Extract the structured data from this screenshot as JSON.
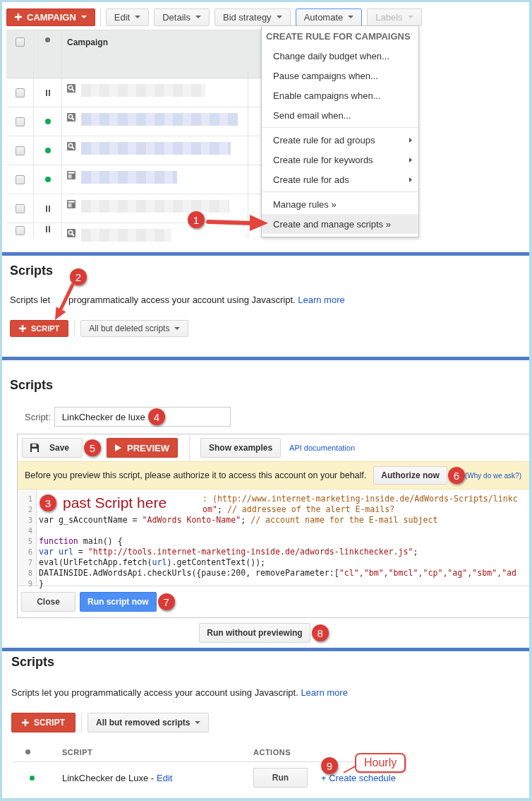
{
  "campaigns": {
    "new_button": "CAMPAIGN",
    "toolbar": [
      {
        "label": "Edit",
        "expanded": false,
        "disabled": false
      },
      {
        "label": "Details",
        "expanded": false,
        "disabled": false
      },
      {
        "label": "Bid strategy",
        "expanded": false,
        "disabled": false
      },
      {
        "label": "Automate",
        "expanded": true,
        "disabled": false
      },
      {
        "label": "Labels",
        "expanded": false,
        "disabled": true
      }
    ],
    "table": {
      "columns": [
        "Campaign"
      ],
      "select_all_checked": false,
      "rows": [
        {
          "checked": false,
          "paused": true,
          "kind": "search"
        },
        {
          "checked": false,
          "paused": false,
          "kind": "search"
        },
        {
          "checked": false,
          "paused": false,
          "kind": "search"
        },
        {
          "checked": false,
          "paused": false,
          "kind": "display"
        },
        {
          "checked": false,
          "paused": true,
          "kind": "display"
        },
        {
          "checked": false,
          "paused": true,
          "kind": "search"
        }
      ]
    },
    "automate_menu": {
      "heading": "CREATE RULE FOR CAMPAIGNS",
      "groups": [
        {
          "items": [
            {
              "label": "Change daily budget when...",
              "submenu": false,
              "selected": false
            },
            {
              "label": "Pause campaigns when...",
              "submenu": false,
              "selected": false
            },
            {
              "label": "Enable campaigns when...",
              "submenu": false,
              "selected": false
            },
            {
              "label": "Send email when...",
              "submenu": false,
              "selected": false
            }
          ]
        },
        {
          "items": [
            {
              "label": "Create rule for ad groups",
              "submenu": true,
              "selected": false
            },
            {
              "label": "Create rule for keywords",
              "submenu": true,
              "selected": false
            },
            {
              "label": "Create rule for ads",
              "submenu": true,
              "selected": false
            }
          ]
        },
        {
          "items": [
            {
              "label": "Manage rules »",
              "submenu": false,
              "selected": false
            },
            {
              "label": "Create and manage scripts »",
              "submenu": false,
              "selected": true
            }
          ]
        }
      ]
    },
    "step_marker": "1"
  },
  "scripts_intro": {
    "title": "Scripts",
    "description_parts": [
      "Scripts let",
      "programmatically access your account using Javascript."
    ],
    "link": "Learn more",
    "new_button": "SCRIPT",
    "filter": "All but deleted scripts",
    "step_marker": "2"
  },
  "editor": {
    "title": "Scripts",
    "name_label": "Script:",
    "name_value": "LinkChecker de luxe",
    "name_marker": "4",
    "save": "Save",
    "save_marker": "5",
    "preview": "PREVIEW",
    "examples": "Show examples",
    "docs_link": "API documentation",
    "auth_message": "Before you preview this script, please authorize it to access this account on your behalf.",
    "auth_button": "Authorize now",
    "auth_marker": "6",
    "auth_link": "(Why do we ask?)",
    "note": {
      "marker": "3",
      "text": "past Script here"
    },
    "code_lines": [
      {
        "number": "1",
        "tokens": [
          {
            "text": ": (http://www.internet-marketing-inside.de/AdWords-Scripts/linkc",
            "kind": "comment"
          }
        ]
      },
      {
        "number": "2",
        "tokens": [
          {
            "text": "om\"",
            "kind": "string"
          },
          {
            "text": "; ",
            "kind": "plain"
          },
          {
            "text": "// addressee of the alert E-mails?",
            "kind": "comment"
          }
        ]
      },
      {
        "number": "3",
        "tokens": [
          {
            "text": "var g_sAccountName = ",
            "kind": "plain"
          },
          {
            "text": "\"AdWords Konto-Name\"",
            "kind": "string"
          },
          {
            "text": "; ",
            "kind": "plain"
          },
          {
            "text": "// account name for the E-mail subject",
            "kind": "comment"
          }
        ]
      },
      {
        "number": "4"
      },
      {
        "number": "5",
        "tokens": [
          {
            "text": "function",
            "kind": "keyword"
          },
          {
            "text": " main() {",
            "kind": "plain"
          }
        ]
      },
      {
        "number": "6",
        "tokens": [
          {
            "text": "var url",
            "kind": "variable"
          },
          {
            "text": " = ",
            "kind": "plain"
          },
          {
            "text": "\"http://tools.internet-marketing-inside.de/adwords-linkchecker.js\"",
            "kind": "string"
          },
          {
            "text": ";",
            "kind": "plain"
          }
        ]
      },
      {
        "number": "7",
        "tokens": [
          {
            "text": "eval(UrlFetchApp.fetch(",
            "kind": "plain"
          },
          {
            "text": "url",
            "kind": "variable"
          },
          {
            "text": ").getContentText());",
            "kind": "plain"
          }
        ]
      },
      {
        "number": "8",
        "tokens": [
          {
            "text": "DATAINSIDE.AdWordsApi.checkUrls({pause:200, removeParameter:[",
            "kind": "plain"
          },
          {
            "text": "\"cl\",\"bm\",\"bmcl\",\"cp\",\"ag\",\"sbm\",\"ad",
            "kind": "string"
          }
        ]
      },
      {
        "number": "9",
        "tokens": [
          {
            "text": "}",
            "kind": "plain"
          }
        ]
      }
    ],
    "close": "Close",
    "run_now": "Run script now",
    "run_marker": "7",
    "run_without": "Run without previewing",
    "run_without_marker": "8"
  },
  "scripts_list": {
    "title": "Scripts",
    "description": "Scripts let you programmatically access your account using Javascript.",
    "link": "Learn more",
    "new_button": "SCRIPT",
    "filter": "All but removed scripts",
    "columns": [
      "SCRIPT",
      "ACTIONS"
    ],
    "rows": [
      {
        "paused": false,
        "name": "LinkChecker de Luxe -",
        "edit_link": "Edit",
        "run_button": "Run",
        "schedule_link": "+ Create schedule",
        "step_marker": "9",
        "callout": "Hourly"
      }
    ]
  }
}
